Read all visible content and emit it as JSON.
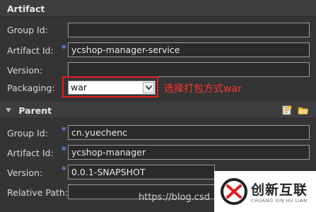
{
  "artifact": {
    "header": "Artifact",
    "group_id": {
      "label": "Group Id:",
      "value": ""
    },
    "artifact_id": {
      "label": "Artifact Id:",
      "value": "ycshop-manager-service",
      "required_mark": "*"
    },
    "version": {
      "label": "Version:",
      "value": ""
    },
    "packaging": {
      "label": "Packaging:",
      "value": "war"
    }
  },
  "annotation": "选择打包方式war",
  "parent": {
    "header": "Parent",
    "group_id": {
      "label": "Group Id:",
      "value": "cn.yuechenc",
      "required_mark": "*"
    },
    "artifact_id": {
      "label": "Artifact Id:",
      "value": "ycshop-manager",
      "required_mark": "*"
    },
    "version": {
      "label": "Version:",
      "value": "0.0.1-SNAPSHOT",
      "required_mark": "*"
    },
    "relative_path": {
      "label": "Relative Path:",
      "value": ""
    },
    "icons": [
      "add-dependency-icon",
      "browse-folder-icon"
    ]
  },
  "watermark": {
    "url": "https://blog.csd",
    "brand": "创新互联",
    "brand_sub": "CHUANG XIN HU LIAN"
  },
  "colors": {
    "background": "#343434",
    "required": "#5a8fe0",
    "highlight": "#e02020",
    "annotation": "#ff3333"
  }
}
